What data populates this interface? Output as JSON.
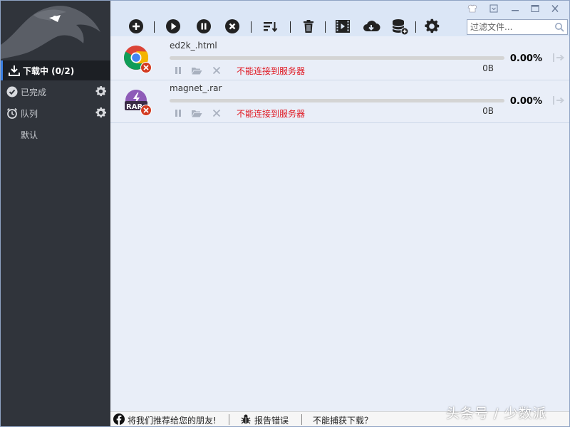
{
  "sidebar": {
    "items": [
      {
        "label": "下载中 (0/2)",
        "icon": "download-icon",
        "selected": true
      },
      {
        "label": "已完成",
        "icon": "check-circle-icon"
      },
      {
        "label": "队列",
        "icon": "alarm-clock-icon"
      },
      {
        "label": "默认"
      }
    ]
  },
  "toolbar": {
    "buttons": [
      "add",
      "start",
      "pause",
      "stop",
      "sort",
      "delete",
      "video",
      "cloud-download",
      "database-add",
      "settings"
    ]
  },
  "search": {
    "placeholder": "过滤文件..."
  },
  "downloads": [
    {
      "name": "ed2k_.html",
      "status": "不能连接到服务器",
      "size": "0B",
      "percent": "0.00%",
      "progress": 0,
      "icon": "chrome-icon"
    },
    {
      "name": "magnet_.rar",
      "status": "不能连接到服务器",
      "size": "0B",
      "percent": "0.00%",
      "progress": 0,
      "icon": "rar-icon"
    }
  ],
  "statusbar": {
    "share": "将我们推荐给您的朋友!",
    "report": "报告错误",
    "cannot_capture": "不能捕获下载？"
  },
  "watermark": "头条号 / 少数派",
  "colors": {
    "sidebar": "#30343b",
    "accent": "#3b7fe0",
    "error": "#e0141e",
    "toolbar": "#dbe6f6",
    "list": "#e9eef8"
  }
}
